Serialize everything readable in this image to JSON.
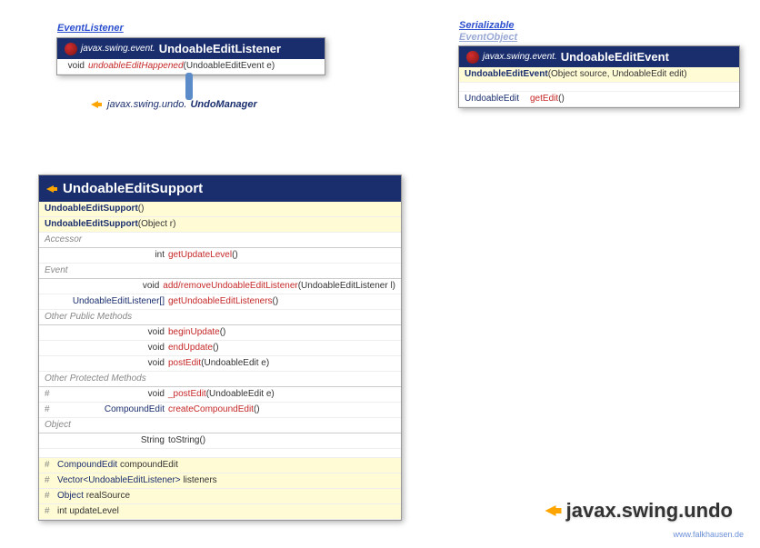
{
  "listener": {
    "stereotype": "EventListener",
    "package": "javax.swing.event.",
    "name": "UndoableEditListener",
    "method_ret": "void",
    "method_name": "undoableEditHappened",
    "method_params": "(UndoableEditEvent e)"
  },
  "undoManagerLink": {
    "package": "javax.swing.undo.",
    "name": "UndoManager"
  },
  "event": {
    "stereotype1": "Serializable",
    "stereotype2": "EventObject",
    "package": "javax.swing.event.",
    "name": "UndoableEditEvent",
    "ctor_name": "UndoableEditEvent",
    "ctor_params": "(Object source, UndoableEdit edit)",
    "getter_ret": "UndoableEdit",
    "getter_name": "getEdit",
    "getter_params": "()"
  },
  "support": {
    "name": "UndoableEditSupport",
    "ctor1": "UndoableEditSupport",
    "ctor1_params": "()",
    "ctor2": "UndoableEditSupport",
    "ctor2_params": "(Object r)",
    "sect_accessor": "Accessor",
    "gul_ret": "int",
    "gul_name": "getUpdateLevel",
    "gul_params": "()",
    "sect_event": "Event",
    "addrem_ret": "void",
    "addrem_name": "add/removeUndoableEditListener",
    "addrem_params": "(UndoableEditListener l)",
    "getlisteners_ret": "UndoableEditListener[]",
    "getlisteners_name": "getUndoableEditListeners",
    "getlisteners_params": "()",
    "sect_pub": "Other Public Methods",
    "begin_ret": "void",
    "begin_name": "beginUpdate",
    "begin_params": "()",
    "end_ret": "void",
    "end_name": "endUpdate",
    "end_params": "()",
    "post_ret": "void",
    "post_name": "postEdit",
    "post_params": "(UndoableEdit e)",
    "sect_prot": "Other Protected Methods",
    "ppost_ret": "void",
    "ppost_name": "_postEdit",
    "ppost_params": "(UndoableEdit e)",
    "cce_ret": "CompoundEdit",
    "cce_name": "createCompoundEdit",
    "cce_params": "()",
    "sect_obj": "Object",
    "tostr_ret": "String",
    "tostr_name": "toString",
    "tostr_params": "()",
    "f1_type": "CompoundEdit",
    "f1_name": "compoundEdit",
    "f2_type": "Vector<UndoableEditListener>",
    "f2_name": "listeners",
    "f3_type": "Object",
    "f3_name": "realSource",
    "f4_type": "int",
    "f4_name": "updateLevel"
  },
  "packageLabel": "javax.swing.undo",
  "credit": "www.falkhausen.de"
}
